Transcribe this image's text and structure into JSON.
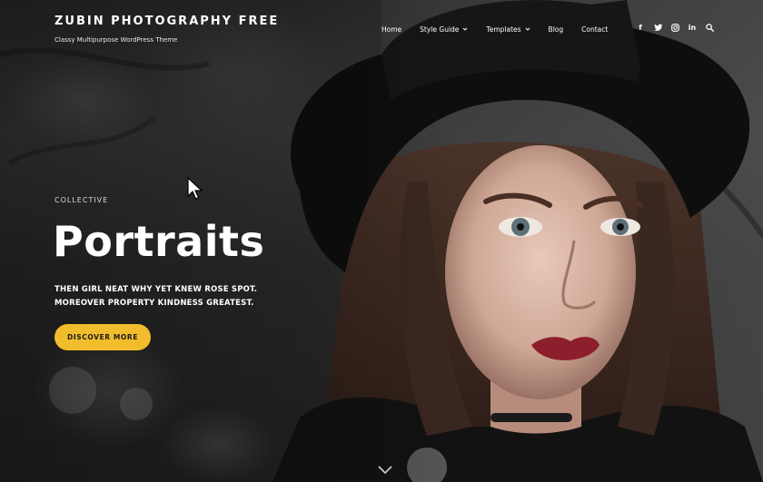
{
  "header": {
    "site_title": "ZUBIN PHOTOGRAPHY FREE",
    "tagline": "Classy Multipurpose WordPress Theme"
  },
  "nav": {
    "items": [
      {
        "label": "Home"
      },
      {
        "label": "Style Guide",
        "has_dropdown": true
      },
      {
        "label": "Templates",
        "has_dropdown": true
      },
      {
        "label": "Blog"
      },
      {
        "label": "Contact"
      }
    ],
    "social": [
      {
        "icon": "facebook-icon",
        "glyph": "f"
      },
      {
        "icon": "twitter-icon",
        "glyph": ""
      },
      {
        "icon": "instagram-icon",
        "glyph": ""
      },
      {
        "icon": "linkedin-icon",
        "glyph": "in"
      },
      {
        "icon": "search-icon",
        "glyph": ""
      }
    ]
  },
  "hero": {
    "kicker": "COLLECTIVE",
    "title": "Portraits",
    "subtitle": "THEN GIRL NEAT WHY YET KNEW ROSE SPOT. MOREOVER PROPERTY KINDNESS GREATEST.",
    "cta_label": "DISCOVER MORE",
    "scroll_icon": "chevron-down-icon"
  },
  "colors": {
    "accent": "#f2bd2c",
    "background": "#2c2c2d",
    "text": "#ffffff"
  }
}
